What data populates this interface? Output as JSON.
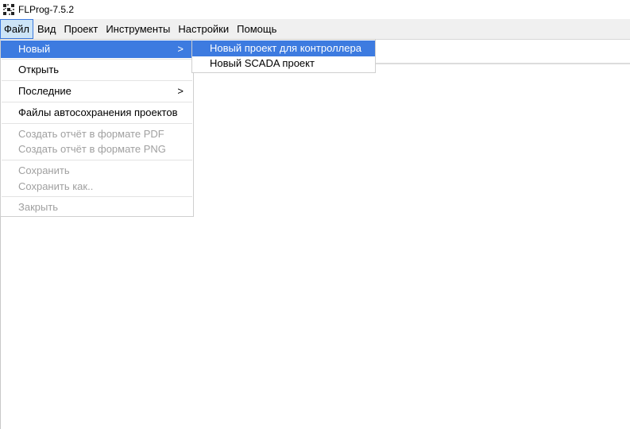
{
  "window": {
    "title": "FLProg-7.5.2",
    "icon": "flprog-app-icon"
  },
  "menubar": {
    "items": [
      {
        "label": "Файл",
        "active": true
      },
      {
        "label": "Вид"
      },
      {
        "label": "Проект"
      },
      {
        "label": "Инструменты"
      },
      {
        "label": "Настройки"
      },
      {
        "label": "Помощь"
      }
    ]
  },
  "file_menu": {
    "new": {
      "label": "Новый",
      "arrow": ">"
    },
    "open": {
      "label": "Открыть"
    },
    "recent": {
      "label": "Последние",
      "arrow": ">"
    },
    "autosave": {
      "label": "Файлы автосохранения проектов"
    },
    "report_pdf": {
      "label": "Создать отчёт в формате PDF"
    },
    "report_png": {
      "label": "Создать отчёт в формате PNG"
    },
    "save": {
      "label": "Сохранить"
    },
    "save_as": {
      "label": "Сохранить как.."
    },
    "close": {
      "label": "Закрыть"
    }
  },
  "new_submenu": {
    "controller_project": {
      "label": "Новый проект для контроллера"
    },
    "scada_project": {
      "label": "Новый SCADA проект"
    }
  },
  "colors": {
    "highlight": "#3d7be0",
    "menubar_bg": "#f0f0f0",
    "disabled_text": "#a0a0a0"
  }
}
